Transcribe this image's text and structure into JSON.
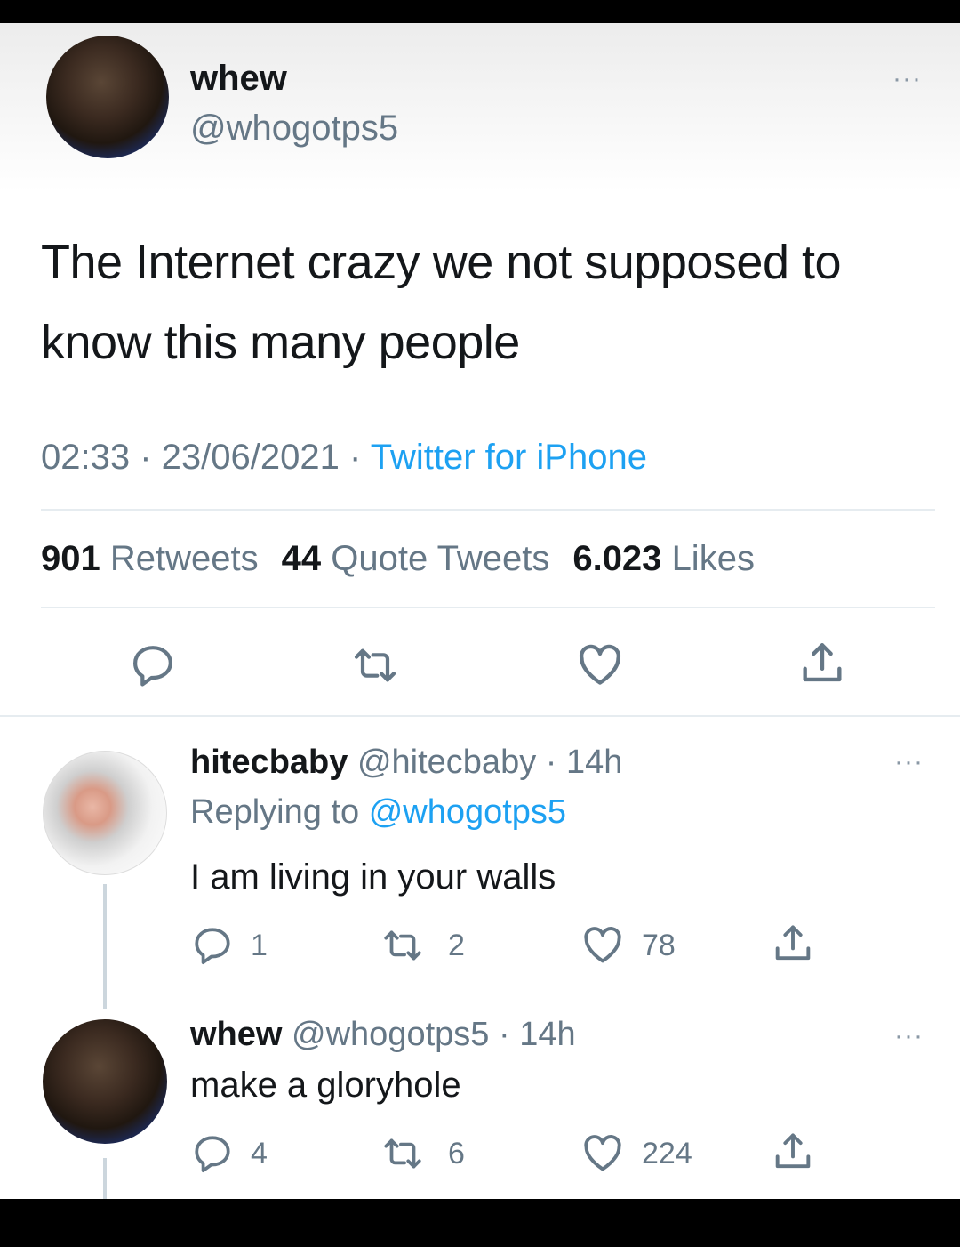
{
  "main_tweet": {
    "author_name": "whew",
    "author_handle": "@whogotps5",
    "text": "The Internet crazy we not supposed to know this many people",
    "time": "02:33",
    "date": "23/06/2021",
    "source": "Twitter for iPhone",
    "retweets_count": "901",
    "retweets_label": "Retweets",
    "quotes_count": "44",
    "quotes_label": "Quote Tweets",
    "likes_count": "6.023",
    "likes_label": "Likes",
    "more_label": "···"
  },
  "replies": [
    {
      "author_name": "hitecbaby",
      "author_handle": "@hitecbaby",
      "age": "14h",
      "replying_prefix": "Replying to",
      "replying_to": "@whogotps5",
      "text": "I am living in your walls",
      "reply_count": "1",
      "retweet_count": "2",
      "like_count": "78",
      "more_label": "···"
    },
    {
      "author_name": "whew",
      "author_handle": "@whogotps5",
      "age": "14h",
      "text": "make a gloryhole",
      "reply_count": "4",
      "retweet_count": "6",
      "like_count": "224",
      "more_label": "···"
    }
  ],
  "icons": [
    "reply-icon",
    "retweet-icon",
    "like-icon",
    "share-icon",
    "more-icon"
  ],
  "colors": {
    "link_blue": "#1da1f2",
    "secondary_text": "#657786",
    "primary_text": "#14171a",
    "divider": "#e6ecf0"
  }
}
